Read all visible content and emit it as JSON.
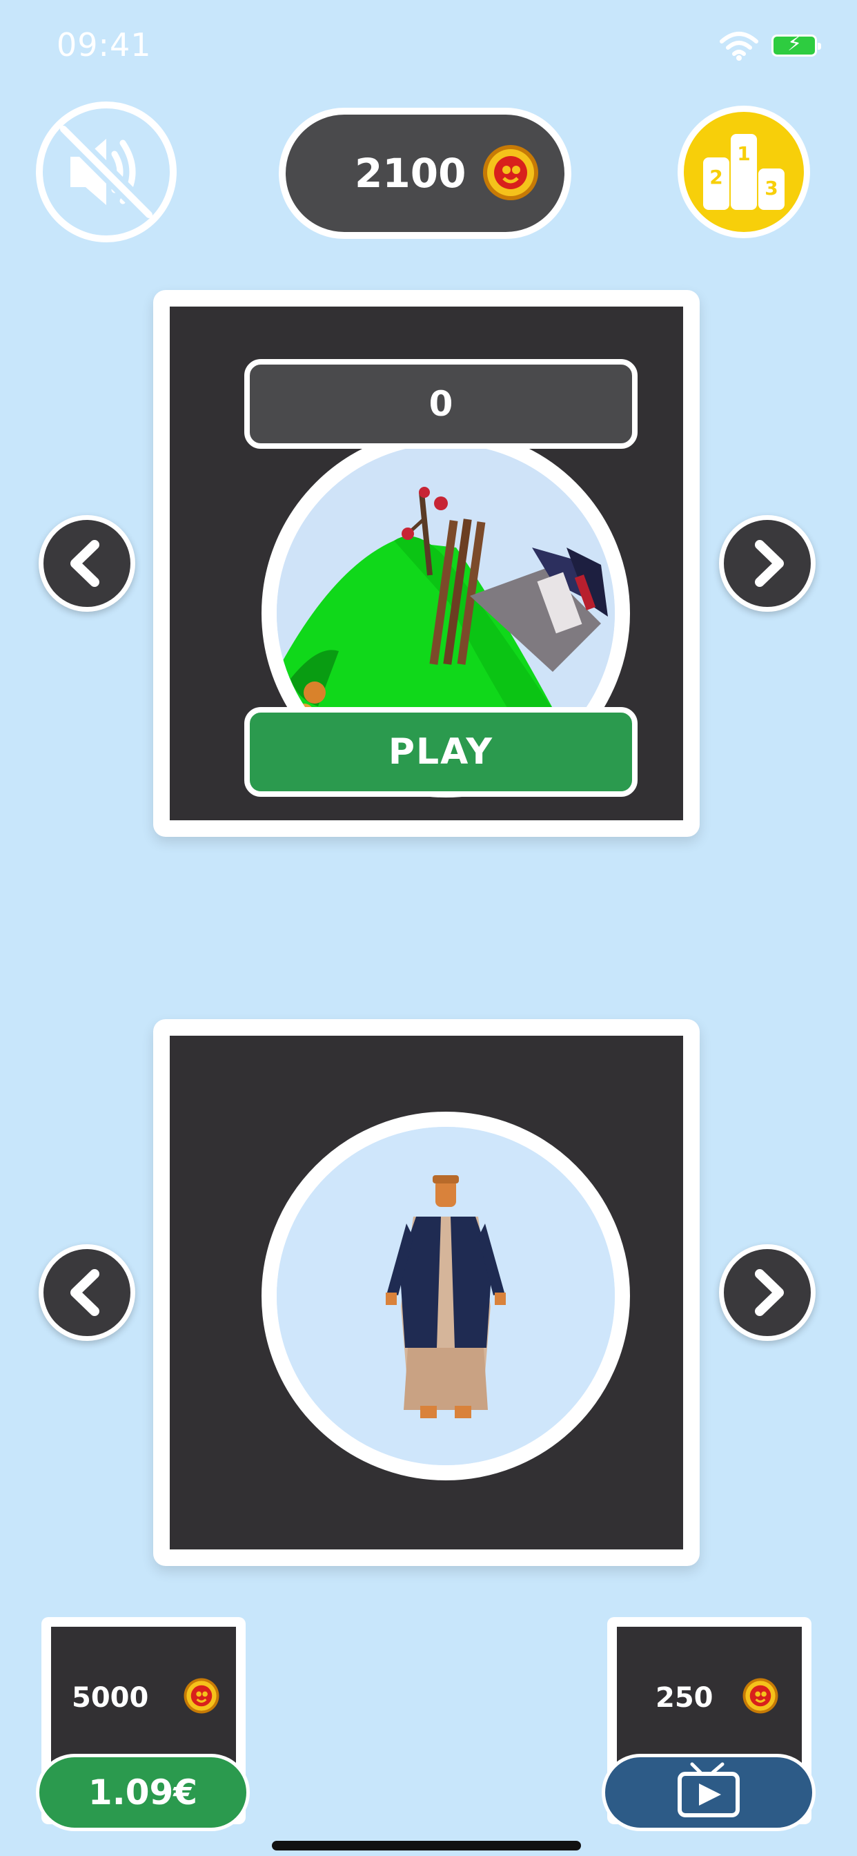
{
  "status_bar": {
    "time": "09:41"
  },
  "header": {
    "coins": "2100"
  },
  "level_card": {
    "best_score": "0",
    "play_label": "PLAY"
  },
  "shop": {
    "left_amount": "5000",
    "left_price": "1.09€",
    "right_amount": "250"
  },
  "icons": {
    "sound": "speaker-muted-icon",
    "coin": "coin-icon",
    "leaderboard": "podium-icon",
    "prev": "chevron-left-icon",
    "next": "chevron-right-icon",
    "ad": "tv-play-icon"
  },
  "colors": {
    "background": "#c8e6fb",
    "panel": "#323033",
    "pill": "#4a4a4c",
    "play_green": "#2b9a4e",
    "leaderboard_yellow": "#f7cf0a",
    "watch_blue": "#2d5b87"
  }
}
